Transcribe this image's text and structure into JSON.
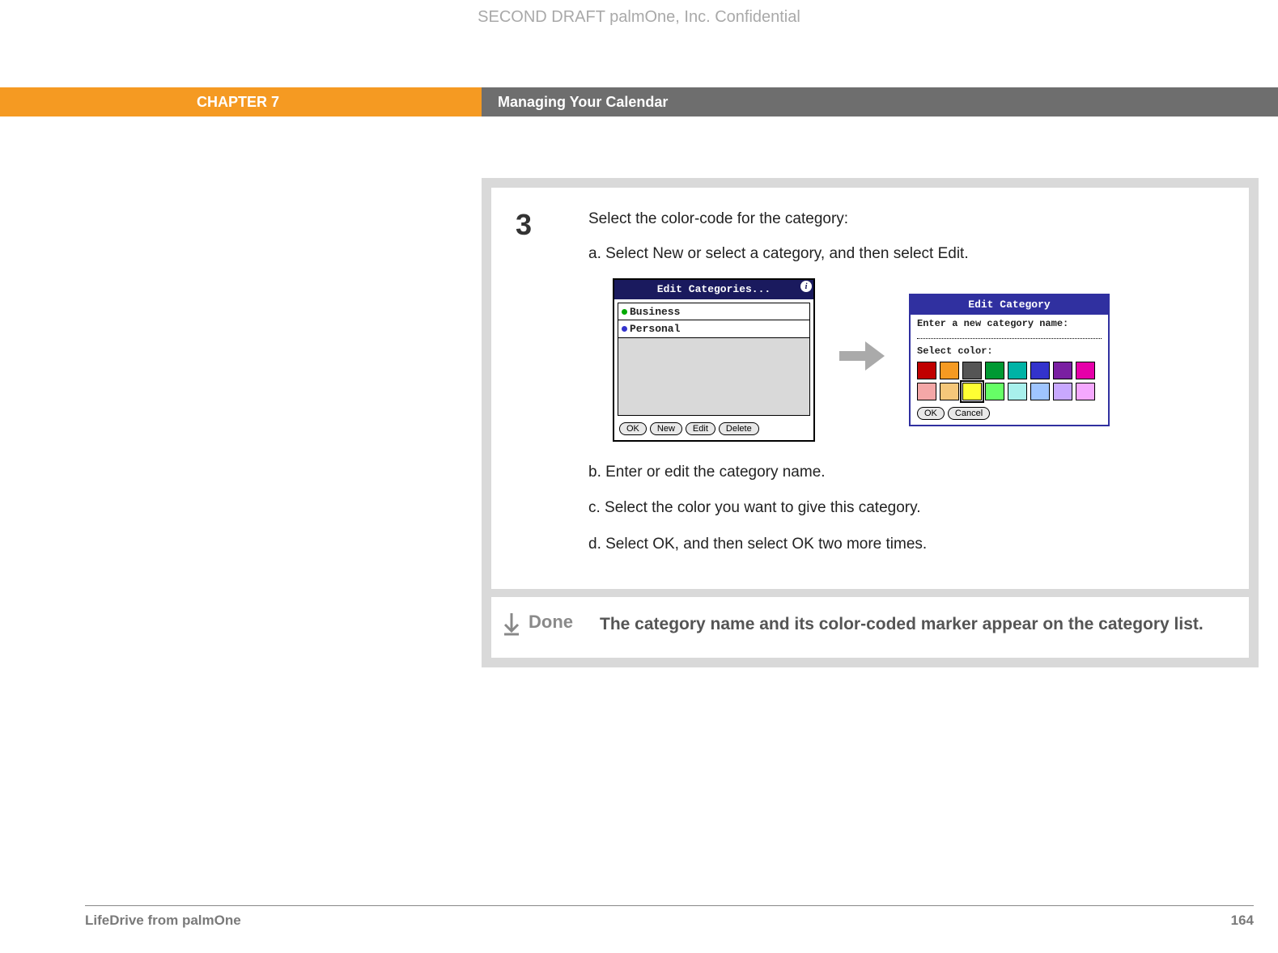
{
  "watermark": "SECOND DRAFT palmOne, Inc.  Confidential",
  "chapter": {
    "left": "CHAPTER 7",
    "right": "Managing Your Calendar"
  },
  "step": {
    "number": "3",
    "intro": "Select the color-code for the category:",
    "items": [
      "a.  Select New or select a category, and then select Edit.",
      "b.  Enter or edit the category name.",
      "c.  Select the color you want to give this category.",
      "d.  Select OK, and then select OK two more times."
    ]
  },
  "dlg1": {
    "title": "Edit Categories...",
    "items": [
      "Business",
      "Personal"
    ],
    "buttons": {
      "ok": "OK",
      "new": "New",
      "edit": "Edit",
      "delete": "Delete"
    }
  },
  "dlg2": {
    "title": "Edit Category",
    "enter_label": "Enter a new category name:",
    "select_label": "Select color:",
    "colors_row1": [
      "#c00000",
      "#f59a22",
      "#555555",
      "#009933",
      "#00b3a6",
      "#3333cc",
      "#7a1fa2",
      "#e600a9"
    ],
    "colors_row2": [
      "#f4a7a7",
      "#f5c77a",
      "#ffff33",
      "#66ff66",
      "#a8f0ec",
      "#9fc5ff",
      "#c8a8ff",
      "#f5a8ff"
    ],
    "selected_index": 10,
    "buttons": {
      "ok": "OK",
      "cancel": "Cancel"
    }
  },
  "done": {
    "label": "Done",
    "text": "The category name and its color-coded marker appear on the category list."
  },
  "footer": {
    "left": "LifeDrive from palmOne",
    "right": "164"
  }
}
